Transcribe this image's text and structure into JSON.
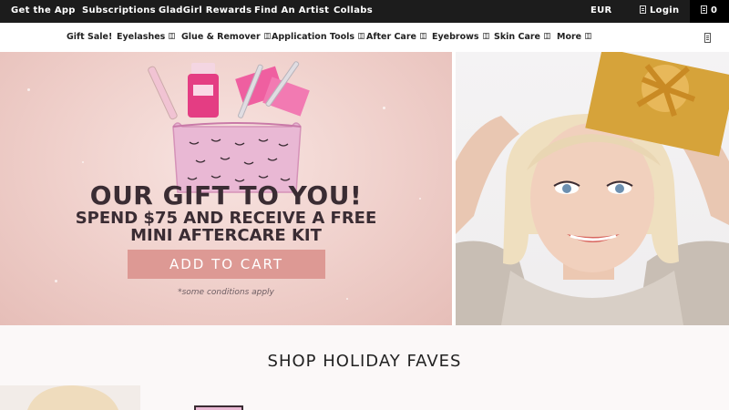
{
  "topbar": {
    "links": [
      "Get the App",
      "Subscriptions",
      "GladGirl Rewards",
      "Find An Artist",
      "Collabs"
    ],
    "currency": "EUR",
    "login_label": "Login",
    "cart_count": "0"
  },
  "nav": {
    "items": [
      "Gift Sale!",
      "Eyelashes",
      "Glue & Remover",
      "Application Tools",
      "After Care",
      "Eyebrows",
      "Skin Care",
      "More"
    ]
  },
  "hero": {
    "headline": "OUR GIFT TO YOU!",
    "subline_1": "SPEND $75 AND RECEIVE A FREE",
    "subline_2": "MINI AFTERCARE KIT",
    "cta_label": "ADD TO CART",
    "note": "*some conditions apply"
  },
  "section": {
    "title": "SHOP HOLIDAY FAVES"
  },
  "colors": {
    "topbar_bg": "#1c1c1c",
    "cta_bg": "#dd9994",
    "hero_bg": "#efcfca",
    "text_dark": "#3a2c33"
  }
}
